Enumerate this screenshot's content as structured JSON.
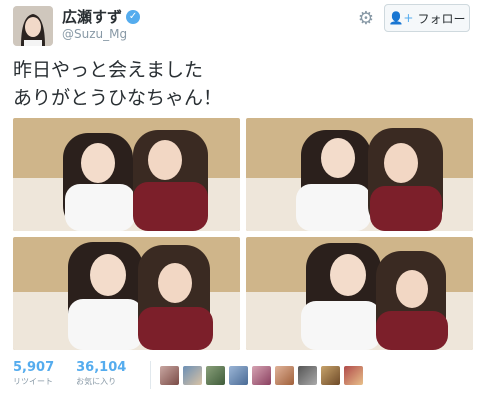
{
  "profile": {
    "display_name": "広瀬すず",
    "handle": "@Suzu_Mg",
    "verified": true,
    "verified_icon": "verified-badge-icon"
  },
  "header": {
    "gear_icon": "gear-icon",
    "follow_label": "フォロー",
    "follow_icon": "person-add-icon"
  },
  "tweet": {
    "lines": [
      "昨日やっと会えました",
      "ありがとうひなちゃん！"
    ]
  },
  "photos": [
    {
      "name": "photo-1"
    },
    {
      "name": "photo-2"
    },
    {
      "name": "photo-3"
    },
    {
      "name": "photo-4"
    }
  ],
  "stats": {
    "retweets": {
      "count": "5,907",
      "label": "リツイート"
    },
    "likes": {
      "count": "36,104",
      "label": "お気に入り"
    }
  },
  "likers_count": 9,
  "colors": {
    "accent": "#55acee",
    "text": "#292f33",
    "muted": "#8899a6"
  }
}
